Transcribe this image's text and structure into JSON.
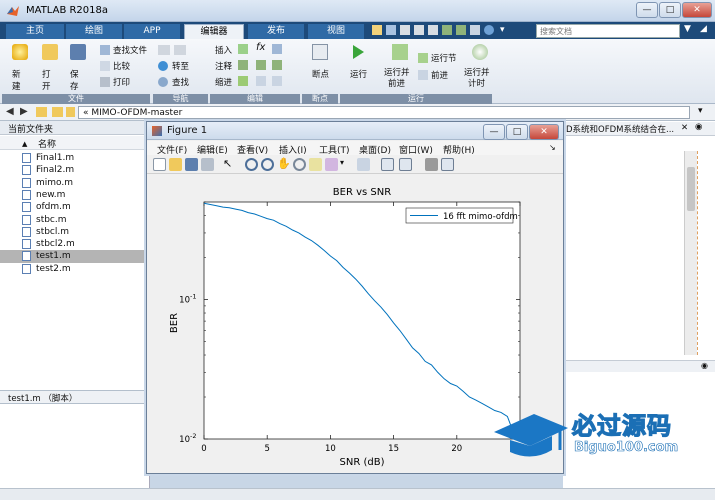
{
  "app": {
    "title": "MATLAB R2018a"
  },
  "window_controls": {
    "minimize": "—",
    "maximize": "□",
    "close": "✕"
  },
  "tabs": [
    {
      "label": "主页"
    },
    {
      "label": "绘图"
    },
    {
      "label": "APP"
    },
    {
      "label": "编辑器"
    },
    {
      "label": "发布"
    },
    {
      "label": "视图"
    }
  ],
  "search": {
    "placeholder": "搜索文档"
  },
  "ribbon": {
    "file": {
      "new": "新建",
      "open": "打开",
      "save": "保存",
      "find_files": "查找文件",
      "compare": "比较",
      "print": "打印",
      "group": "文件"
    },
    "nav": {
      "goto": "转至",
      "find": "查找",
      "group": "导航"
    },
    "edit": {
      "insert": "插入",
      "comment": "注释",
      "indent": "缩进",
      "group": "编辑"
    },
    "breakpoint": {
      "label": "断点",
      "group": "断点"
    },
    "run": {
      "run": "运行",
      "run_advance_1": "运行并",
      "run_advance_2": "前进",
      "run_section": "运行节",
      "advance": "前进",
      "run_time_1": "运行并",
      "run_time_2": "计时",
      "group": "运行"
    }
  },
  "address": {
    "path": "« MIMO-OFDM-master"
  },
  "current_folder": {
    "title": "当前文件夹",
    "column_name": "名称",
    "files": [
      "Final1.m",
      "Final2.m",
      "mimo.m",
      "new.m",
      "ofdm.m",
      "stbc.m",
      "stbcl.m",
      "stbcl2.m",
      "test1.m",
      "test2.m"
    ],
    "selected": "test1.m",
    "details": "test1.m （脚本）"
  },
  "editor": {
    "tab_text": "D系统和OFDM系统结合在..."
  },
  "figure": {
    "title": "Figure 1",
    "menus": [
      "文件(F)",
      "编辑(E)",
      "查看(V)",
      "插入(I)",
      "工具(T)",
      "桌面(D)",
      "窗口(W)",
      "帮助(H)"
    ]
  },
  "watermark": {
    "brand": "必过源码",
    "url": "Biguo100.com"
  },
  "chart_data": {
    "type": "line",
    "title": "BER vs SNR",
    "xlabel": "SNR (dB)",
    "ylabel": "BER",
    "xlim": [
      0,
      25
    ],
    "ylim": [
      0.01,
      0.5
    ],
    "yscale": "log",
    "xticks": [
      "0",
      "5",
      "10",
      "15",
      "20",
      "25"
    ],
    "yticks": [
      {
        "value": 0.01,
        "label": "10",
        "exp": "-2"
      },
      {
        "value": 0.1,
        "label": "10",
        "exp": "-1"
      }
    ],
    "legend_position": "top-right",
    "grid": false,
    "series": [
      {
        "name": "16 fft mimo-ofdm",
        "color": "#0072bd",
        "x": [
          0,
          0.5,
          1,
          1.5,
          2,
          2.5,
          3,
          3.5,
          4,
          4.5,
          5,
          5.5,
          6,
          6.5,
          7,
          7.5,
          8,
          8.5,
          9,
          9.5,
          10,
          10.5,
          11,
          11.5,
          12,
          12.5,
          13,
          13.5,
          14,
          14.5,
          15,
          15.5,
          16,
          16.5,
          17,
          17.5,
          18,
          18.5,
          19,
          19.5,
          20,
          20.5,
          21,
          21.5,
          22,
          22.5,
          23,
          23.5,
          24,
          24.5,
          25
        ],
        "y": [
          0.49,
          0.48,
          0.47,
          0.46,
          0.455,
          0.445,
          0.435,
          0.42,
          0.41,
          0.395,
          0.38,
          0.37,
          0.35,
          0.335,
          0.315,
          0.3,
          0.28,
          0.265,
          0.245,
          0.225,
          0.205,
          0.19,
          0.17,
          0.155,
          0.14,
          0.125,
          0.11,
          0.098,
          0.088,
          0.078,
          0.068,
          0.06,
          0.052,
          0.045,
          0.041,
          0.036,
          0.034,
          0.03,
          0.027,
          0.025,
          0.024,
          0.022,
          0.02,
          0.019,
          0.018,
          0.017,
          0.016,
          0.0155,
          0.0145,
          0.011,
          0.01
        ]
      }
    ]
  }
}
